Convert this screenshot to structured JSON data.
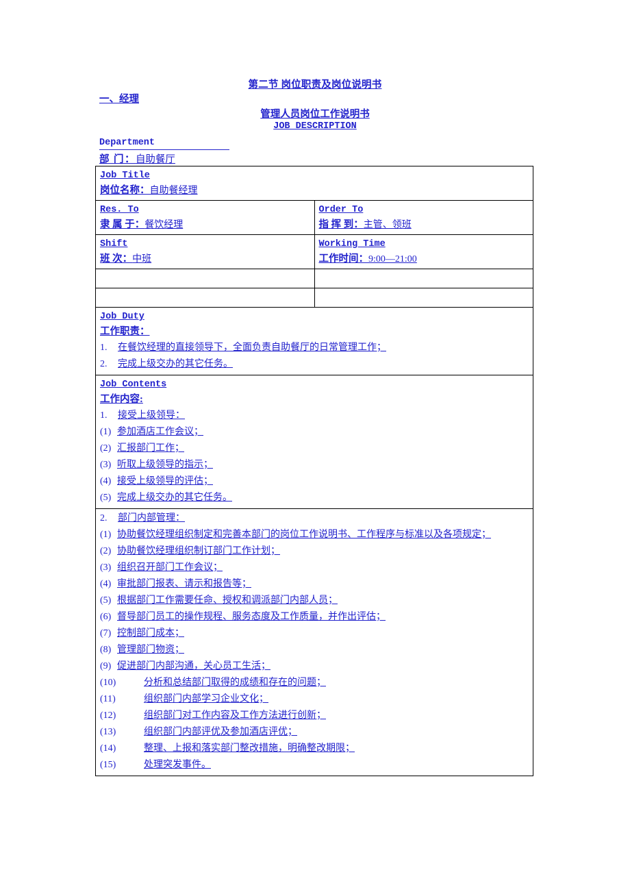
{
  "document": {
    "title": "第二节 岗位职责及岗位说明书",
    "section_heading": "一、经理",
    "subtitle_cn": "管理人员岗位工作说明书",
    "subtitle_en": "JOB DESCRIPTION",
    "text_color": "#2222cc",
    "border_color": "#000000"
  },
  "department": {
    "label_en": "Department",
    "label_cn": "部    门：",
    "value": "自助餐厅"
  },
  "table": {
    "job_title": {
      "label_en": "Job Title",
      "label_cn": "岗位名称：",
      "value": "自助餐经理"
    },
    "res_to": {
      "label_en": "Res. To",
      "label_cn": "隶 属 于：",
      "value": "餐饮经理"
    },
    "order_to": {
      "label_en": "Order To",
      "label_cn": "指 挥 到：",
      "value": "主管、领班"
    },
    "shift": {
      "label_en": "Shift",
      "label_cn": "班    次：",
      "value": "中班"
    },
    "working_time": {
      "label_en": "Working Time",
      "label_cn": "工作时间：",
      "value": "9:00—21:00"
    },
    "empty_rows": 2,
    "job_duty": {
      "label_en": "Job Duty",
      "label_cn": "工作职责：",
      "items": [
        {
          "num": "1.",
          "text": "在餐饮经理的直接领导下，全面负责自助餐厅的日常管理工作；"
        },
        {
          "num": "2.",
          "text": "完成上级交办的其它任务。"
        }
      ]
    },
    "job_contents": {
      "label_en": "Job Contents",
      "label_cn": "工作内容:",
      "group1": {
        "num": "1.",
        "text": "接受上级领导：",
        "items": [
          {
            "num": "(1)",
            "text": "参加酒店工作会议；"
          },
          {
            "num": "(2)",
            "text": "汇报部门工作；"
          },
          {
            "num": "(3)",
            "text": "听取上级领导的指示；"
          },
          {
            "num": "(4)",
            "text": "接受上级领导的评估；"
          },
          {
            "num": "(5)",
            "text": "完成上级交办的其它任务。"
          }
        ]
      },
      "group2": {
        "num": "2.",
        "text": "部门内部管理：",
        "items": [
          {
            "num": "(1)",
            "text": "协助餐饮经理组织制定和完善本部门的岗位工作说明书、工作程序与标准以及各项规定；",
            "wrap": true
          },
          {
            "num": "(2)",
            "text": "协助餐饮经理组织制订部门工作计划；"
          },
          {
            "num": "(3)",
            "text": "组织召开部门工作会议；"
          },
          {
            "num": "(4)",
            "text": "审批部门报表、请示和报告等；"
          },
          {
            "num": "(5)",
            "text": "根据部门工作需要任命、授权和调派部门内部人员；"
          },
          {
            "num": "(6)",
            "text": "督导部门员工的操作规程、服务态度及工作质量，并作出评估；"
          },
          {
            "num": "(7)",
            "text": "控制部门成本；"
          },
          {
            "num": "(8)",
            "text": "管理部门物资；"
          },
          {
            "num": "(9)",
            "text": "促进部门内部沟通，关心员工生活；"
          },
          {
            "num": "(10)",
            "text": "分析和总结部门取得的成绩和存在的问题；",
            "wide": true
          },
          {
            "num": "(11)",
            "text": "组织部门内部学习企业文化；",
            "wide": true
          },
          {
            "num": "(12)",
            "text": "组织部门对工作内容及工作方法进行创新；",
            "wide": true
          },
          {
            "num": "(13)",
            "text": "组织部门内部评优及参加酒店评优；",
            "wide": true
          },
          {
            "num": "(14)",
            "text": "整理、上报和落实部门整改措施，明确整改期限；",
            "wide": true
          },
          {
            "num": "(15)",
            "text": "处理突发事件。",
            "wide": true
          }
        ]
      }
    }
  }
}
